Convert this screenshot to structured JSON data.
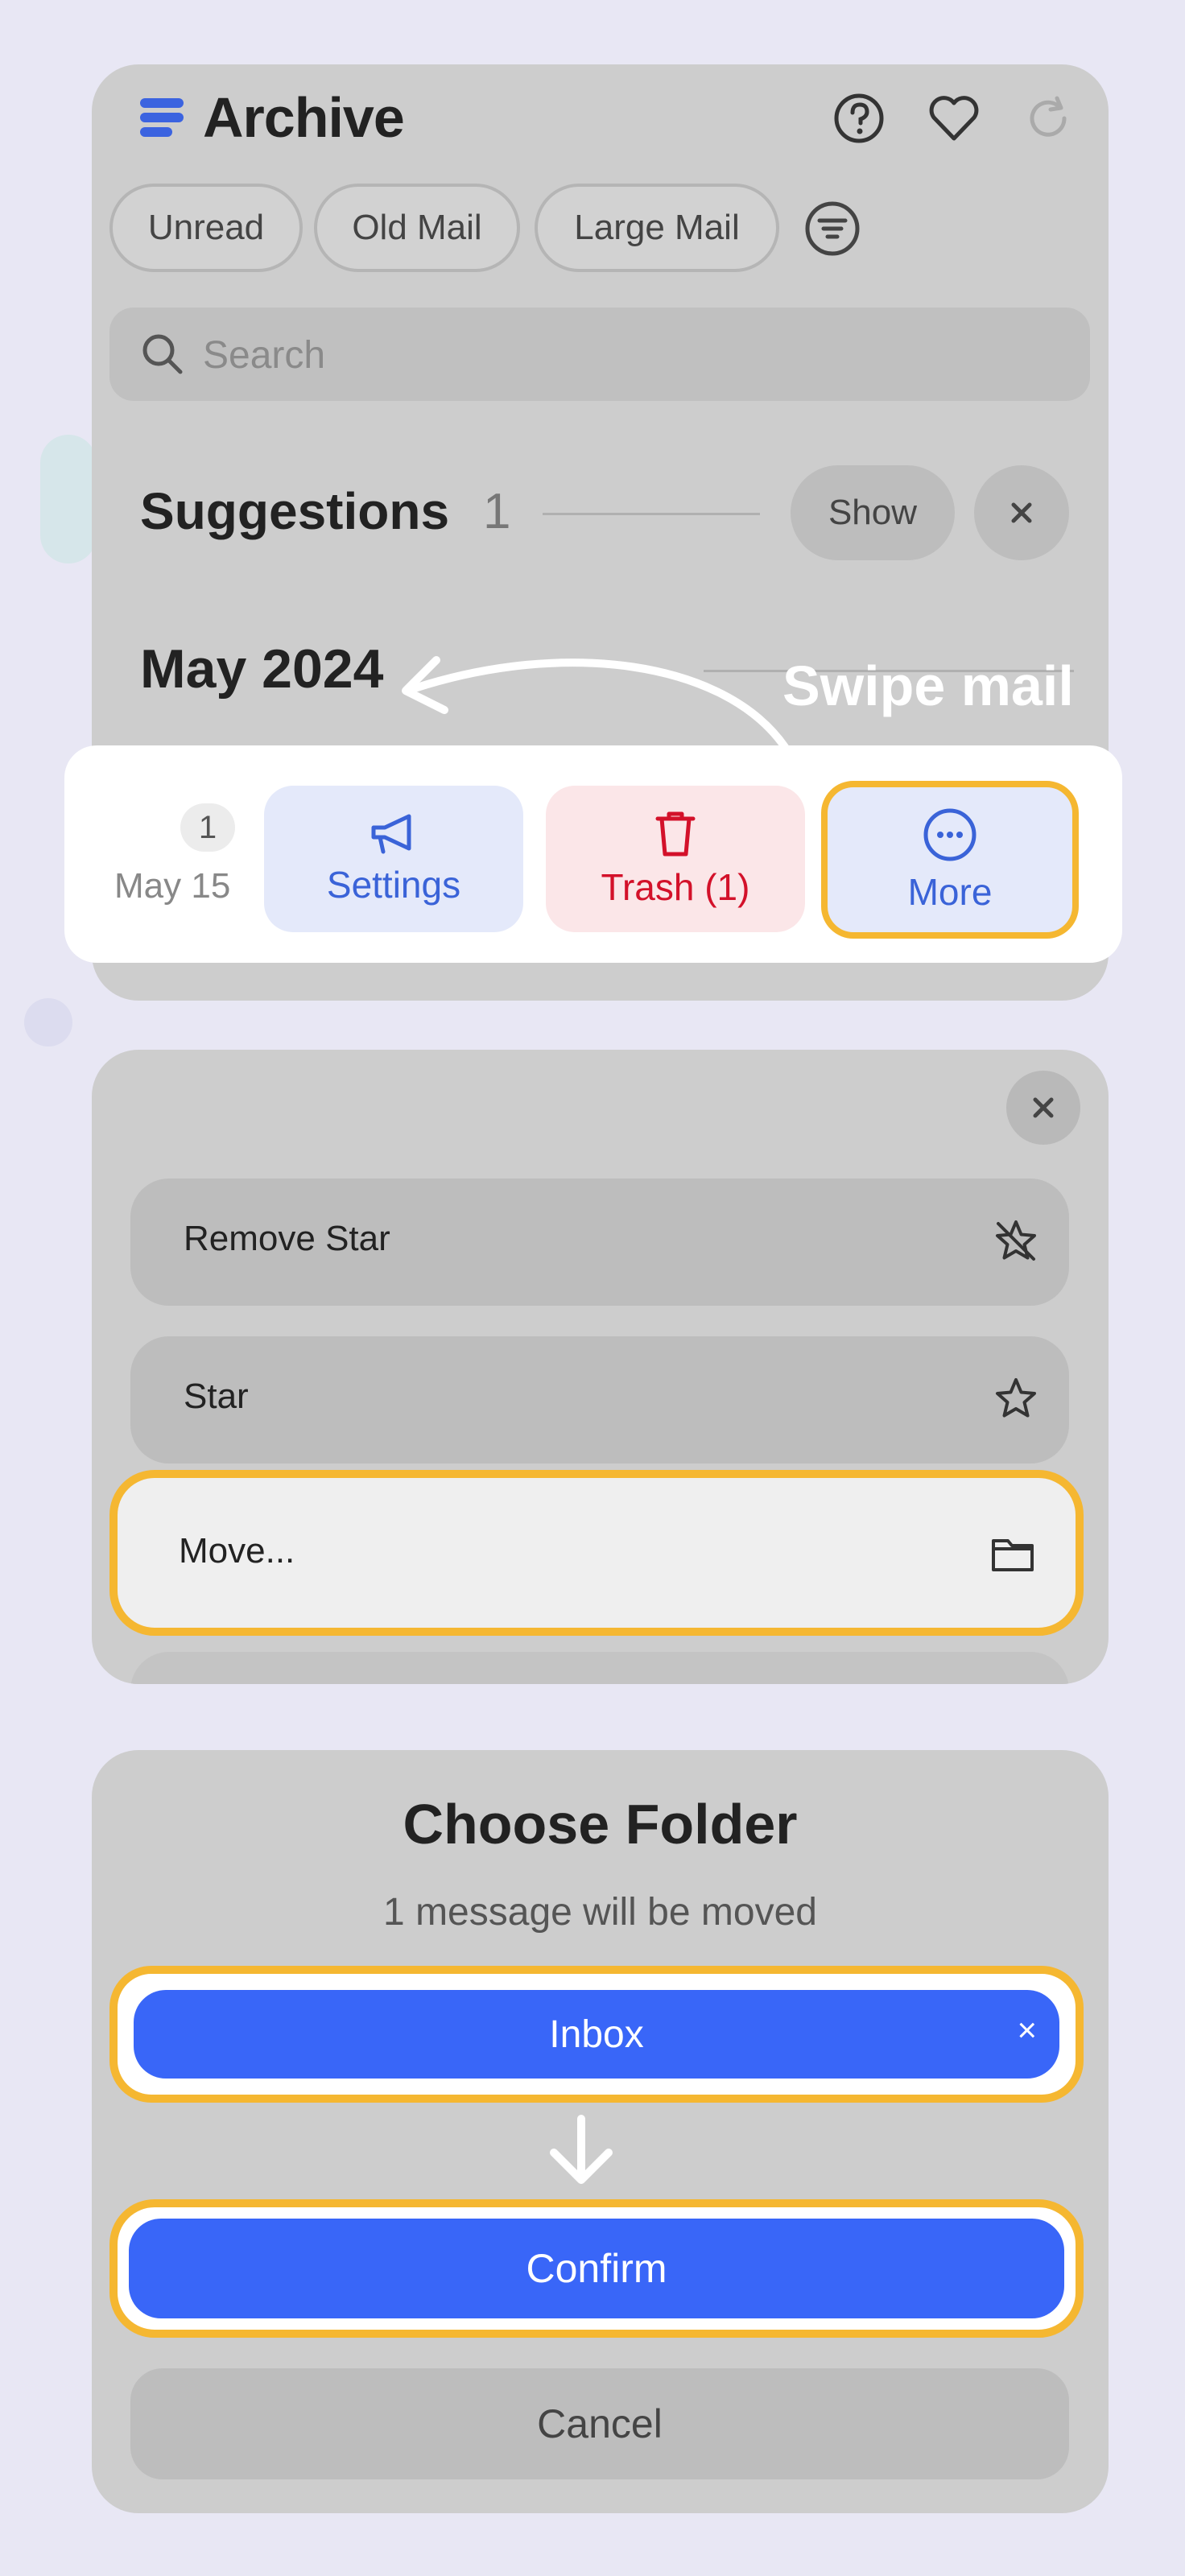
{
  "header": {
    "title": "Archive"
  },
  "filters": {
    "chips": [
      "Unread",
      "Old Mail",
      "Large Mail"
    ]
  },
  "search": {
    "placeholder": "Search"
  },
  "suggestions": {
    "title": "Suggestions",
    "count": "1",
    "show_label": "Show"
  },
  "month": "May 2024",
  "annotation": {
    "swipe_label": "Swipe mail"
  },
  "swipe": {
    "badge": "1",
    "date": "May 15",
    "actions": {
      "settings": "Settings",
      "trash": "Trash (1)",
      "more": "More"
    }
  },
  "more_menu": {
    "items": [
      {
        "label": "Remove Star",
        "icon": "star-off-icon"
      },
      {
        "label": "Star",
        "icon": "star-icon"
      },
      {
        "label": "Move...",
        "icon": "folder-icon"
      }
    ]
  },
  "choose_folder": {
    "title": "Choose Folder",
    "subtitle": "1 message will be moved",
    "selected_folder": "Inbox",
    "clear_symbol": "×",
    "confirm_label": "Confirm",
    "cancel_label": "Cancel"
  },
  "colors": {
    "accent": "#3966f8",
    "highlight": "#f5b731",
    "danger": "#d3112a",
    "background": "#e8e7f4"
  }
}
